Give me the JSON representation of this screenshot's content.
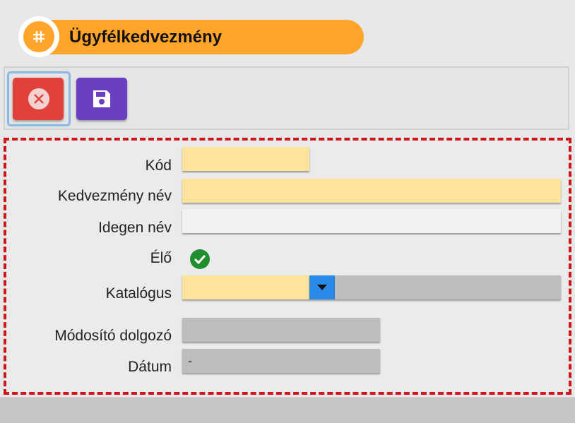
{
  "header": {
    "title": "Ügyfélkedvezmény",
    "icon": "hash-icon"
  },
  "toolbar": {
    "close_button_icon": "close-circle-icon",
    "save_button_icon": "floppy-disk-icon",
    "colors": {
      "close": "#e0413a",
      "save": "#6a3fc2",
      "title": "#ffa52b"
    }
  },
  "form": {
    "kod": {
      "label": "Kód",
      "value": ""
    },
    "kedvezmeny_nev": {
      "label": "Kedvezmény név",
      "value": ""
    },
    "idegen_nev": {
      "label": "Idegen név",
      "value": ""
    },
    "elo": {
      "label": "Élő",
      "checked": true
    },
    "katalogus": {
      "label": "Katalógus",
      "value": ""
    },
    "modosito_dolgozo": {
      "label": "Módosító dolgozó",
      "value": ""
    },
    "datum": {
      "label": "Dátum",
      "value": "-"
    }
  }
}
